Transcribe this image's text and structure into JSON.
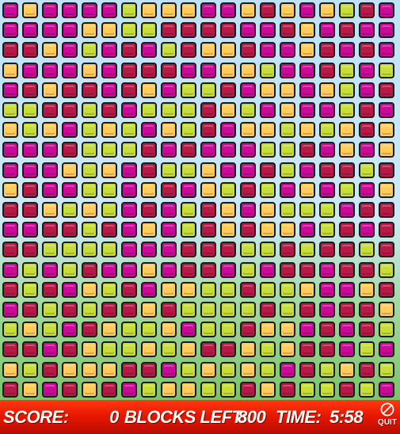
{
  "colors": {
    "Y": "#ffcc5c",
    "G": "#c6dd3a",
    "R": "#b81a47",
    "M": "#cc0a98"
  },
  "grid": [
    "MYMMMMGYYYMMYRYMYGRM",
    "MMMMYYGGRRRRMMRYMRMM",
    "RRYMGMRMGRYYRMMYRMRM",
    "YMMMYMRRRMMYYGMMRGMG",
    "MRYRRMRYMGGRMYYMYGMR",
    "GGRRGRMGGGRYGMYMMGRM",
    "YGYMGYGMYGRMYYGYGYRY",
    "MMMRGGGRMRMMMGGRMYMY",
    "MMMYGYMRGGYMMRGMRRGR",
    "YRMMGGMYRMYGRGMYMGMY",
    "RRYGYGMRMGRYMYGGGMRR",
    "MMRRGRMYMGRYRYYMGRMR",
    "RRGGGGMMMRRRGGRGRRGR",
    "MGMGRMMYMRRMGMRRMRRG",
    "RGRMYGRMYYGGRGGYMMYR",
    "MRGRGRRYRGGGGRGRMRRY",
    "GYGMRYGGYMGGRYYMRMRG",
    "RRMRYGGYGYRRYGYRRMGM",
    "YGRYYYRRMGYGYGMRGYRG",
    "RYMRYRMGYYGGRYRGGRGM"
  ],
  "hud": {
    "score_label": "SCORE:",
    "score": "0",
    "blocks_label": "BLOCKS LEFT:",
    "blocks_left": "800",
    "time_label": "TIME:",
    "time": "5:58",
    "quit_label": "QUIT",
    "quit_icon": "no-entry-icon"
  }
}
